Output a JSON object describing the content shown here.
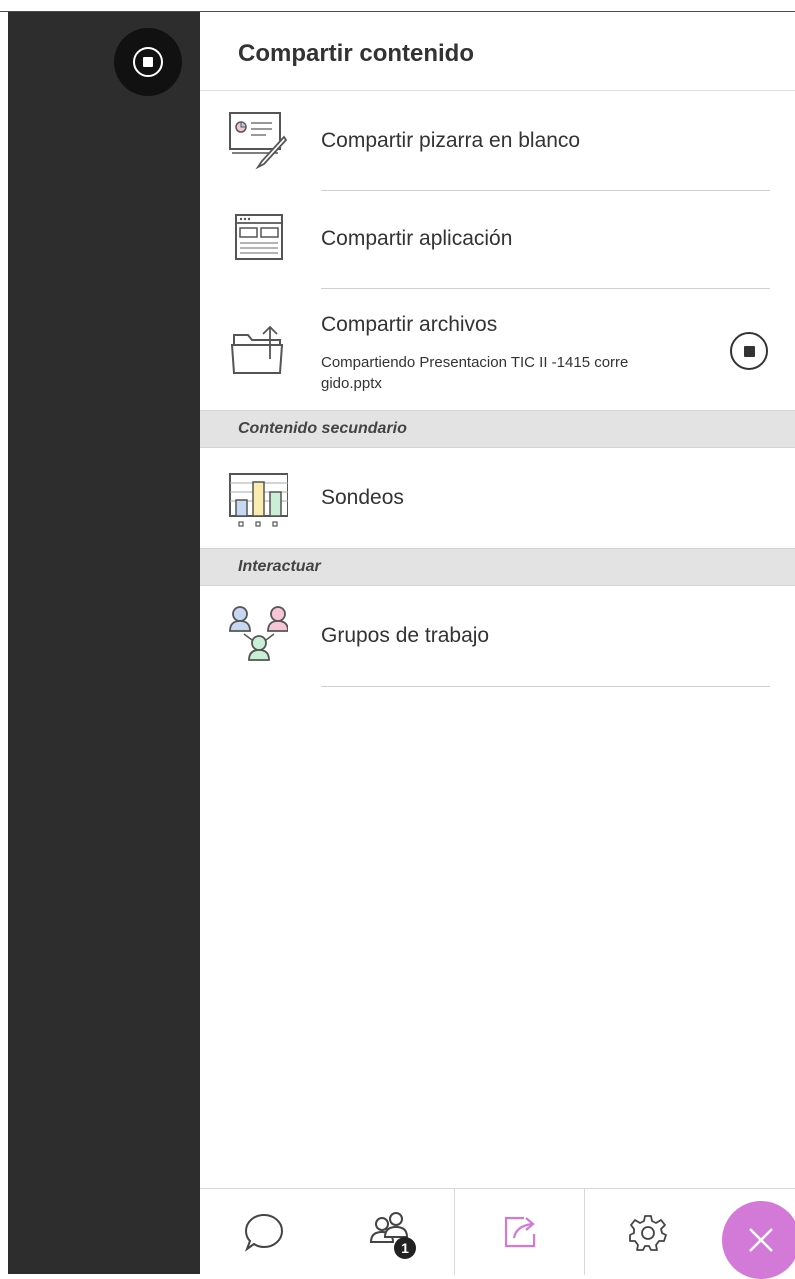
{
  "panel": {
    "title": "Compartir contenido"
  },
  "primary_items": [
    {
      "label": "Compartir pizarra en blanco",
      "icon": "whiteboard-icon"
    },
    {
      "label": "Compartir aplicación",
      "icon": "application-window-icon"
    },
    {
      "label": "Compartir archivos",
      "icon": "folder-upload-icon",
      "status_line1": "Compartiendo Presentacion TIC II -1415 corre",
      "status_line2": "gido.pptx",
      "stop_icon": "stop-sharing-icon"
    }
  ],
  "sections": [
    {
      "header": "Contenido secundario",
      "items": [
        {
          "label": "Sondeos",
          "icon": "polls-chart-icon"
        }
      ]
    },
    {
      "header": "Interactuar",
      "items": [
        {
          "label": "Grupos de trabajo",
          "icon": "breakout-groups-icon"
        }
      ]
    }
  ],
  "bottom_bar": {
    "tabs": [
      {
        "icon": "chat-bubble-icon"
      },
      {
        "icon": "attendees-icon",
        "badge": "1"
      },
      {
        "icon": "share-content-icon",
        "active": true
      },
      {
        "icon": "settings-gear-icon"
      }
    ],
    "close_icon": "close-icon"
  },
  "colors": {
    "dark_column": "#2d2d2d",
    "accent": "#d37ad8",
    "section_header_bg": "#e3e3e3"
  }
}
